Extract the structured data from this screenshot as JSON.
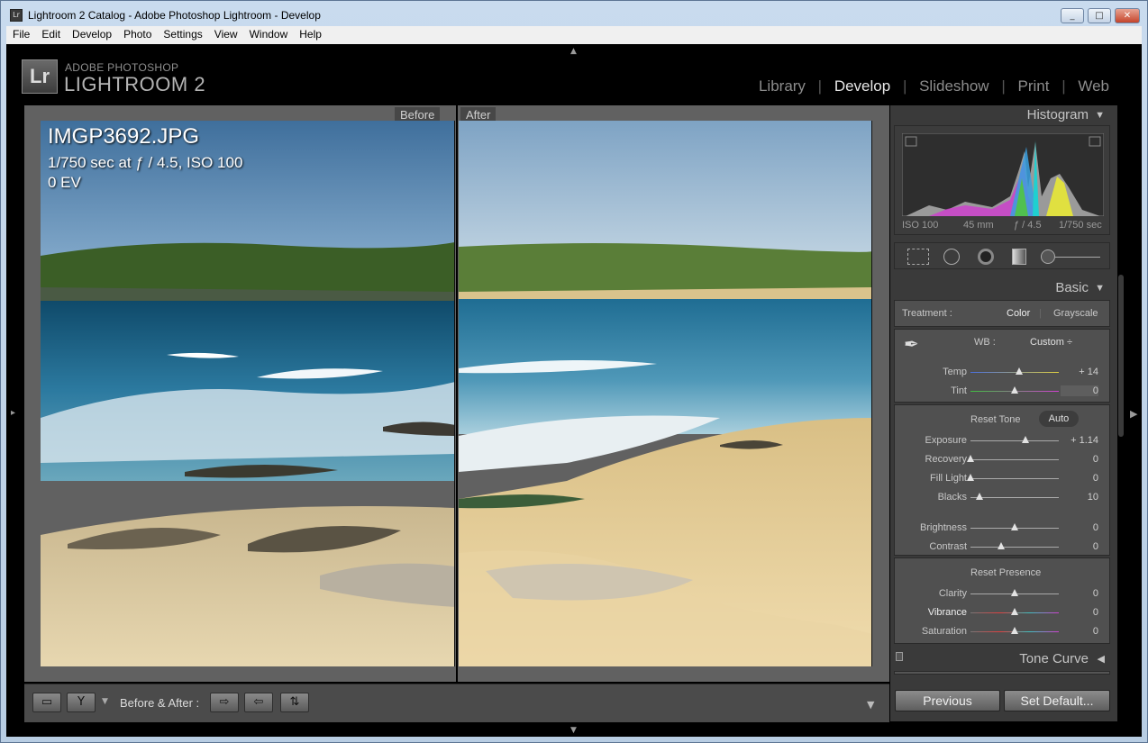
{
  "window": {
    "title": "Lightroom 2 Catalog - Adobe Photoshop Lightroom - Develop",
    "app_icon": "Lr",
    "minimize": "_",
    "maximize": "□",
    "close": "✕"
  },
  "menu": [
    "File",
    "Edit",
    "Develop",
    "Photo",
    "Settings",
    "View",
    "Window",
    "Help"
  ],
  "brand": {
    "logo": "Lr",
    "line1": "ADOBE PHOTOSHOP",
    "line2": "LIGHTROOM 2"
  },
  "modules": {
    "library": "Library",
    "develop": "Develop",
    "slideshow": "Slideshow",
    "print": "Print",
    "web": "Web",
    "sep": "|",
    "active": "Develop"
  },
  "view": {
    "before_label": "Before",
    "after_label": "After",
    "filename": "IMGP3692.JPG",
    "exposure_info": "1/750 sec at ƒ / 4.5, ISO 100",
    "ev": "0 EV"
  },
  "toolbar": {
    "before_after_label": "Before & After :"
  },
  "histogram": {
    "title": "Histogram",
    "iso": "ISO 100",
    "focal": "45 mm",
    "aperture": "ƒ / 4.5",
    "shutter": "1/750 sec"
  },
  "basic": {
    "title": "Basic",
    "treatment_label": "Treatment :",
    "color": "Color",
    "grayscale": "Grayscale",
    "wb_label": "WB :",
    "wb_value": "Custom ÷",
    "reset_tone": "Reset Tone",
    "auto": "Auto",
    "reset_presence": "Reset Presence",
    "sliders": {
      "temp": {
        "label": "Temp",
        "value": "+ 14",
        "level": 0.55
      },
      "tint": {
        "label": "Tint",
        "value": "0",
        "level": 0.5
      },
      "exposure": {
        "label": "Exposure",
        "value": "+ 1.14",
        "level": 0.62
      },
      "recovery": {
        "label": "Recovery",
        "value": "0",
        "level": 0.0
      },
      "fill_light": {
        "label": "Fill Light",
        "value": "0",
        "level": 0.0
      },
      "blacks": {
        "label": "Blacks",
        "value": "10",
        "level": 0.1
      },
      "brightness": {
        "label": "Brightness",
        "value": "0",
        "level": 0.5
      },
      "contrast": {
        "label": "Contrast",
        "value": "0",
        "level": 0.35
      },
      "clarity": {
        "label": "Clarity",
        "value": "0",
        "level": 0.5
      },
      "vibrance": {
        "label": "Vibrance",
        "value": "0",
        "level": 0.5
      },
      "saturation": {
        "label": "Saturation",
        "value": "0",
        "level": 0.5
      }
    }
  },
  "tone_curve": {
    "title": "Tone Curve"
  },
  "buttons": {
    "previous": "Previous",
    "set_default": "Set Default..."
  },
  "colors": {
    "accent_text": "#e6e6e6",
    "panel": "#3a3a3a",
    "panel_box": "#505050"
  }
}
